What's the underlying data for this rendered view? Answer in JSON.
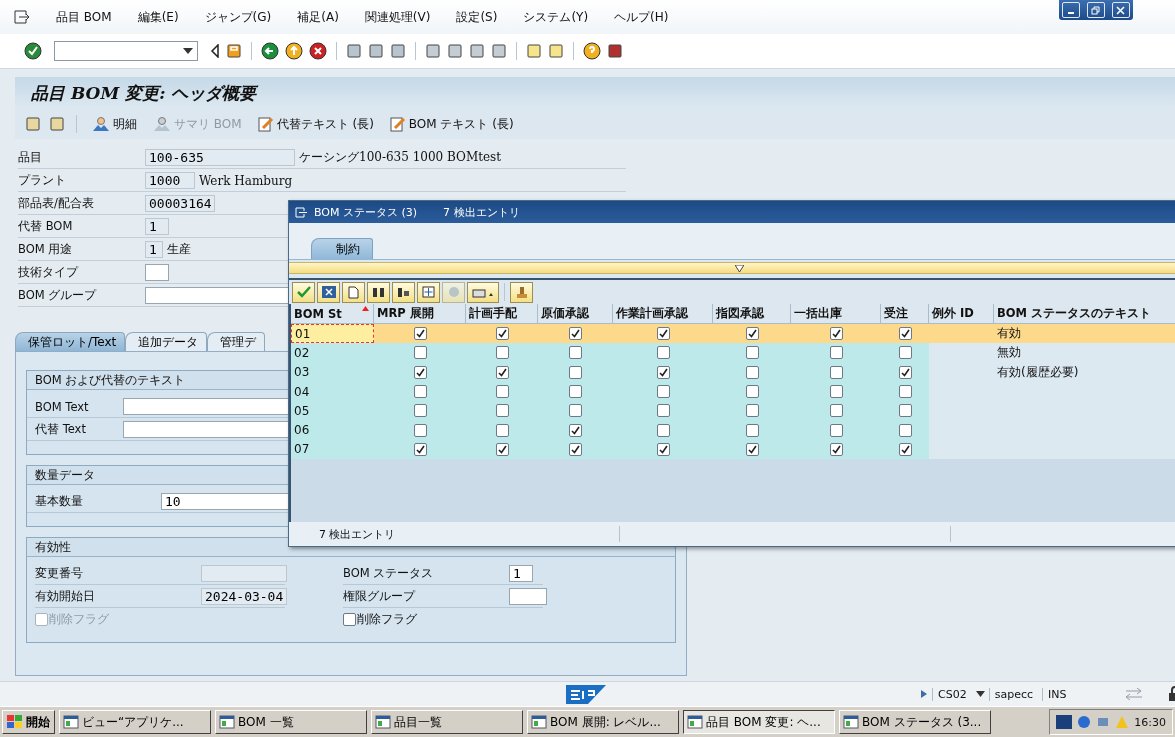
{
  "menu_bar": {
    "items": [
      "品目 BOM",
      "編集(E)",
      "ジャンプ(G)",
      "補足(A)",
      "関連処理(V)",
      "設定(S)",
      "システム(Y)",
      "ヘルプ(H)"
    ]
  },
  "screen_title": "品目 BOM 変更: ヘッダ概要",
  "app_toolbar": {
    "buttons": [
      {
        "label": "明細",
        "disabled": false,
        "kind": "person"
      },
      {
        "label": "サマリ BOM",
        "disabled": true,
        "kind": "person"
      },
      {
        "label": "代替テキスト (長)",
        "disabled": false,
        "kind": "edit"
      },
      {
        "label": "BOM テキスト (長)",
        "disabled": false,
        "kind": "edit"
      }
    ]
  },
  "header_fields": [
    {
      "label": "品目",
      "value": "100-635",
      "description": "ケーシング100-635 1000 BOMtest"
    },
    {
      "label": "プラント",
      "value": "1000",
      "description": "Werk Hamburg"
    },
    {
      "label": "部品表/配合表",
      "value": "00003164"
    },
    {
      "label": "代替 BOM",
      "value": "1"
    },
    {
      "label": "BOM 用途",
      "value": "1",
      "description": "生産"
    },
    {
      "label": "技術タイプ"
    },
    {
      "label": "BOM グループ"
    }
  ],
  "tabs": [
    {
      "label": "保管ロット/Text",
      "selected": true
    },
    {
      "label": "追加データ",
      "selected": false
    },
    {
      "label": "管理デ",
      "selected": false
    }
  ],
  "text_group": {
    "title": "BOM および代替のテキスト",
    "fields": [
      {
        "label": "BOM Text"
      },
      {
        "label": "代替 Text"
      }
    ]
  },
  "quantity_group": {
    "title": "数量データ",
    "fields": [
      {
        "label": "基本数量",
        "value": "10"
      }
    ]
  },
  "validity_group": {
    "title": "有効性",
    "left": [
      {
        "kind": "field",
        "label": "変更番号",
        "disabled": true
      },
      {
        "kind": "field",
        "label": "有効開始日",
        "value": "2024-03-04",
        "disabled": true
      },
      {
        "kind": "checkbox",
        "label": "削除フラグ",
        "checked": false,
        "disabled": true
      }
    ],
    "right": [
      {
        "kind": "field",
        "label": "BOM ステータス",
        "value": "1",
        "disabled": false
      },
      {
        "kind": "field",
        "label": "権限グループ",
        "disabled": false
      },
      {
        "kind": "checkbox",
        "label": "削除フラグ",
        "checked": false,
        "disabled": false
      }
    ]
  },
  "status_bar": {
    "transaction": "CS02",
    "system": "sapecc",
    "mode": "INS"
  },
  "popup": {
    "title": "BOM ステータス (3)",
    "hits": "7 検出エントリ",
    "tabs": [
      {
        "label": "制約",
        "selected": true
      }
    ],
    "columns": [
      "BOM St",
      "MRP 展開",
      "計画手配",
      "原価承認",
      "作業計画承認",
      "指図承認",
      "一括出庫",
      "受注",
      "例外 ID",
      "BOM ステータスのテキスト"
    ],
    "rows": [
      {
        "status": "01",
        "checks": [
          true,
          true,
          true,
          true,
          true,
          true,
          true
        ],
        "text": "有効",
        "selected": true
      },
      {
        "status": "02",
        "checks": [
          false,
          false,
          false,
          false,
          false,
          false,
          false
        ],
        "text": "無効",
        "selected": false
      },
      {
        "status": "03",
        "checks": [
          true,
          true,
          false,
          true,
          false,
          false,
          true
        ],
        "text": "有効(履歴必要)",
        "selected": false
      },
      {
        "status": "04",
        "checks": [
          false,
          false,
          false,
          false,
          false,
          false,
          false
        ],
        "selected": false
      },
      {
        "status": "05",
        "checks": [
          false,
          false,
          false,
          false,
          false,
          false,
          false
        ],
        "selected": false
      },
      {
        "status": "06",
        "checks": [
          false,
          false,
          true,
          false,
          false,
          false,
          false
        ],
        "selected": false
      },
      {
        "status": "07",
        "checks": [
          true,
          true,
          true,
          true,
          true,
          true,
          true
        ],
        "selected": false
      }
    ],
    "footer": "7 検出エントリ"
  },
  "taskbar": {
    "start": "開始",
    "tasks": [
      {
        "label": "ビュー“アプリケ...",
        "selected": false
      },
      {
        "label": "BOM 一覧",
        "selected": false
      },
      {
        "label": "品目一覧",
        "selected": false
      },
      {
        "label": "BOM 展開: レベル...",
        "selected": false
      },
      {
        "label": "品目 BOM 変更: ヘ...",
        "selected": true
      },
      {
        "label": "BOM ステータス (3...",
        "selected": false
      }
    ],
    "clock": "16:30"
  }
}
